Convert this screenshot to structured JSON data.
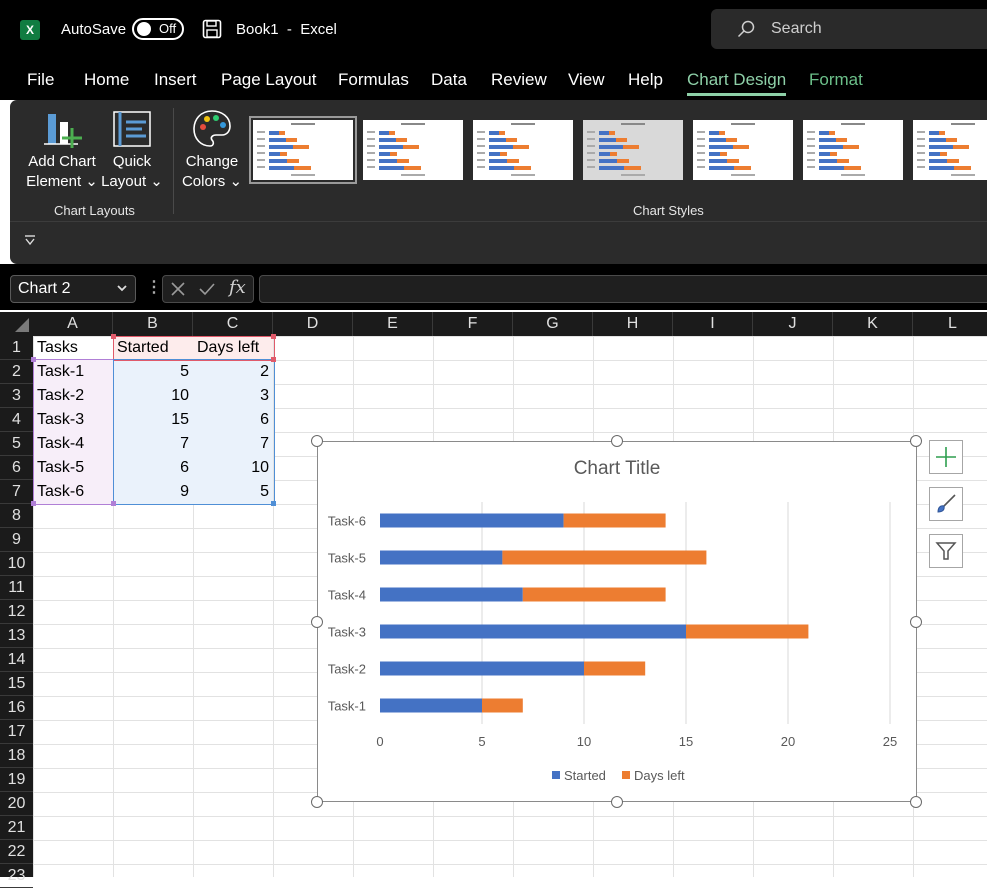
{
  "titlebar": {
    "logo_letter": "X",
    "autosave_label": "AutoSave",
    "autosave_state": "Off",
    "doc_title": "Book1  -  Excel",
    "search_placeholder": "Search"
  },
  "menu": {
    "file": "File",
    "home": "Home",
    "insert": "Insert",
    "page_layout": "Page Layout",
    "formulas": "Formulas",
    "data": "Data",
    "review": "Review",
    "view": "View",
    "help": "Help",
    "chart_design": "Chart Design",
    "format": "Format"
  },
  "ribbon": {
    "add_chart_element": [
      "Add Chart",
      "Element"
    ],
    "quick_layout": [
      "Quick",
      "Layout"
    ],
    "change_colors": [
      "Change",
      "Colors"
    ],
    "group_chart_layouts": "Chart Layouts",
    "group_chart_styles": "Chart Styles"
  },
  "formula_bar": {
    "name_box": "Chart 2",
    "fx": "fx",
    "formula": ""
  },
  "columns": [
    "A",
    "B",
    "C",
    "D",
    "E",
    "F",
    "G",
    "H",
    "I",
    "J",
    "K",
    "L"
  ],
  "rows": [
    "1",
    "2",
    "3",
    "4",
    "5",
    "6",
    "7",
    "8",
    "9",
    "10",
    "11",
    "12",
    "13",
    "14",
    "15",
    "16",
    "17",
    "18",
    "19",
    "20",
    "21",
    "22",
    "23"
  ],
  "sheet": {
    "headers": [
      "Tasks",
      "Started",
      "Days left"
    ],
    "rows": [
      [
        "Task-1",
        "5",
        "2"
      ],
      [
        "Task-2",
        "10",
        "3"
      ],
      [
        "Task-3",
        "15",
        "6"
      ],
      [
        "Task-4",
        "7",
        "7"
      ],
      [
        "Task-5",
        "6",
        "10"
      ],
      [
        "Task-6",
        "9",
        "5"
      ]
    ]
  },
  "colors": {
    "started": "#4472c4",
    "days_left": "#ed7d31",
    "accent": "#8ed0a8"
  },
  "chart_data": {
    "type": "bar",
    "orientation": "horizontal",
    "stacked": true,
    "title": "Chart Title",
    "categories": [
      "Task-1",
      "Task-2",
      "Task-3",
      "Task-4",
      "Task-5",
      "Task-6"
    ],
    "series": [
      {
        "name": "Started",
        "values": [
          5,
          10,
          15,
          7,
          6,
          9
        ]
      },
      {
        "name": "Days left",
        "values": [
          2,
          3,
          6,
          7,
          10,
          5
        ]
      }
    ],
    "xlim": [
      0,
      25
    ],
    "xticks": [
      "0",
      "5",
      "10",
      "15",
      "20",
      "25"
    ],
    "grid": "vertical",
    "legend": "bottom"
  }
}
